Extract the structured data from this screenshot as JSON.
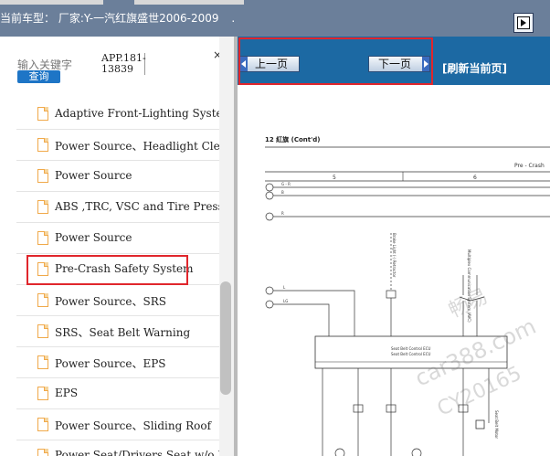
{
  "header": {
    "current_car_label": "当前车型：",
    "manufacturer_label": "厂家:Y-一汽红旗盛世2006-2009",
    "dot": "."
  },
  "search": {
    "keyword_label": "输入关键字",
    "query_button": "查询",
    "code_line1": "APP.181-",
    "code_line2": "13839",
    "corner_mark": "×"
  },
  "tree": {
    "items": [
      "Adaptive Front-Lighting System",
      "Power Source、Headlight Cleaner",
      "Power Source",
      "ABS ,TRC, VSC and Tire Pressure",
      "Power Source",
      "Pre-Crash Safety System",
      "Power Source、SRS",
      "SRS、Seat Belt Warning",
      "Power Source、EPS",
      "EPS",
      "Power Source、Sliding Roof",
      "Power Seat/Drivers Seat w/o Drive"
    ],
    "highlighted_index": 5
  },
  "nav": {
    "prev_label": "上一页",
    "next_label": "下一页",
    "refresh_label": "[刷新当前页]"
  },
  "diagram": {
    "title": "12 紅旗 (Cont'd)",
    "sys_label": "Pre - Crash",
    "col5": "5",
    "col6": "6",
    "ecu1": "Seat Belt Control ECU",
    "ecu2": "Seat Belt Control ECU",
    "wire1": "G - R",
    "wire2": "B",
    "wire3": "R",
    "wire4": "L",
    "wire5": "LG",
    "rotated1": "Brake Light (-) Retractor",
    "rotated2": "Multiplex Communication System (AVC)",
    "rotated3": "Seat Belt Motor"
  },
  "watermark": {
    "line1": "畅易",
    "line2": "car388.com",
    "line3": "CY20165"
  },
  "colors": {
    "topbar": "#6b7f9a",
    "navbar": "#1c69a3",
    "query_button": "#1e75c6",
    "highlight_red": "#e0262c",
    "doc_icon": "#f0a94a"
  }
}
